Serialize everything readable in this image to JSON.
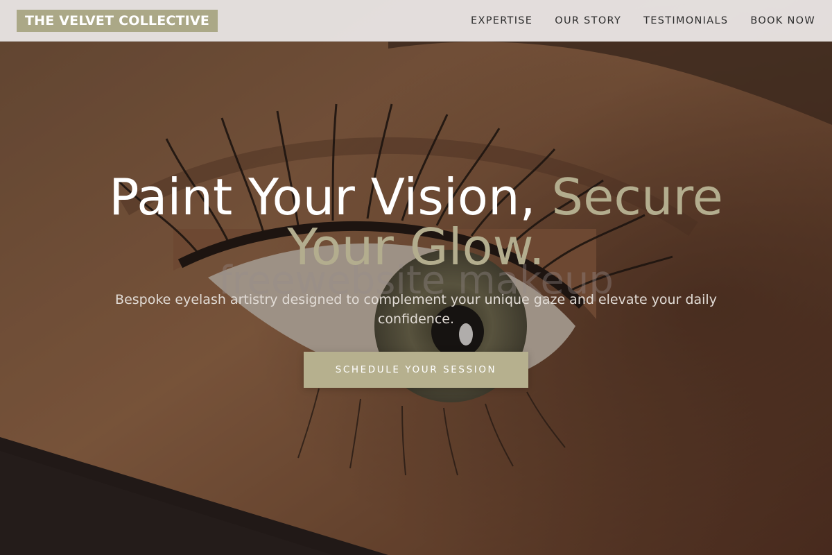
{
  "navbar": {
    "brand": "THE VELVET COLLECTIVE",
    "links": [
      {
        "label": "EXPERTISE"
      },
      {
        "label": "OUR STORY"
      },
      {
        "label": "TESTIMONIALS"
      },
      {
        "label": "BOOK NOW"
      }
    ]
  },
  "hero": {
    "headline_main": "Paint Your Vision, ",
    "headline_accent": "Secure Your Glow.",
    "subtitle": "Bespoke eyelash artistry designed to complement your unique gaze and elevate your daily confidence.",
    "cta_label": "SCHEDULE YOUR SESSION",
    "watermark": "freewebsite makeup",
    "background_image": "eye-closeup-photo"
  },
  "colors": {
    "accent": "#aba887",
    "nav_background": "#ece8e8",
    "nav_text": "#2c2c2c",
    "headline": "#ffffff",
    "subtitle": "#e2dcd6"
  }
}
